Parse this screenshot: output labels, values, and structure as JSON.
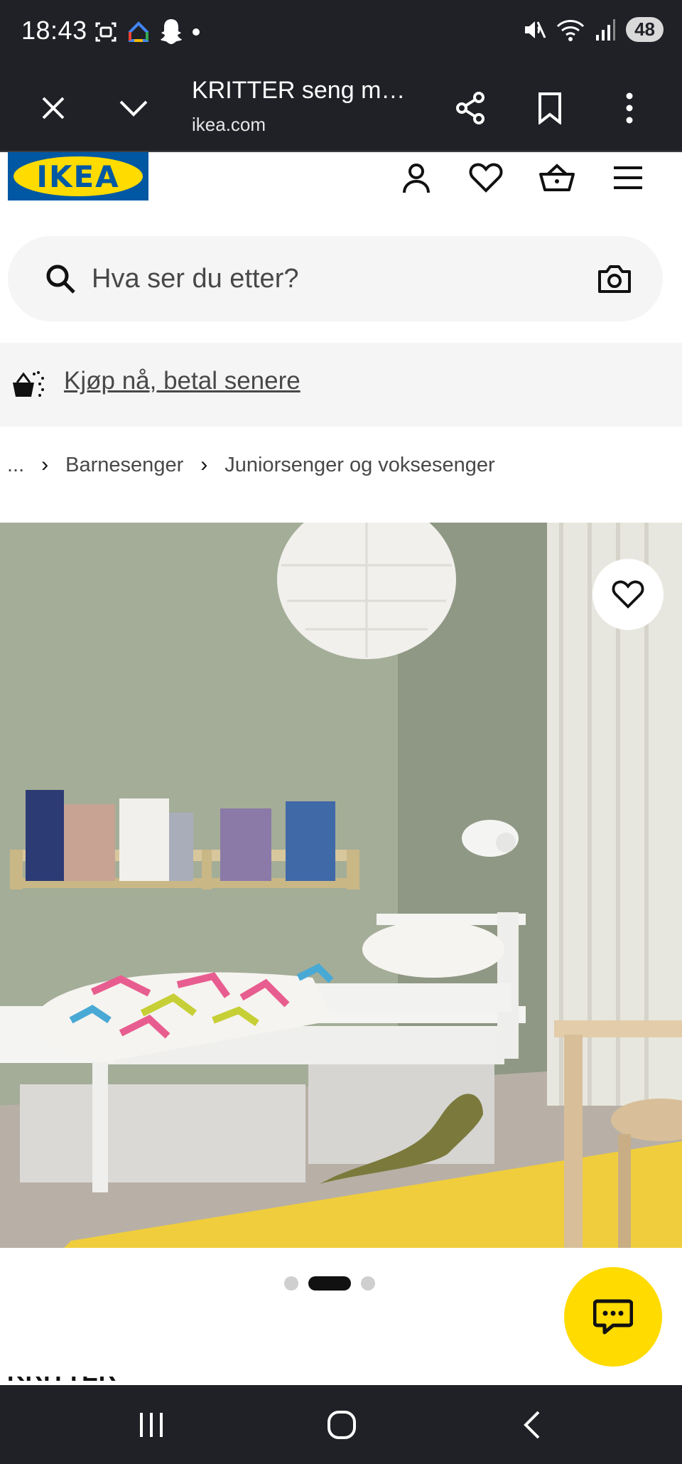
{
  "status_bar": {
    "time": "18:43",
    "battery": "48",
    "icons": [
      "screenshot-icon",
      "google-home-icon",
      "snapchat-icon",
      "notification-dot-icon",
      "mute-icon",
      "wifi-icon",
      "signal-icon"
    ]
  },
  "browser": {
    "title": "KRITTER seng m…",
    "domain": "ikea.com",
    "icons": [
      "close-icon",
      "chevron-down-icon",
      "share-icon",
      "bookmark-icon",
      "more-vertical-icon"
    ]
  },
  "ikea_header": {
    "logo_text": "IKEA",
    "brand_colors": {
      "blue": "#0058a3",
      "yellow": "#ffdb00"
    },
    "icons": [
      "account-icon",
      "heart-icon",
      "cart-icon",
      "menu-icon"
    ]
  },
  "search": {
    "placeholder": "Hva ser du etter?"
  },
  "promo": {
    "link": "Kjøp nå, betal senere"
  },
  "breadcrumb": {
    "ellipsis": "...",
    "items": [
      "Barnesenger",
      "Juniorsenger og voksesenger"
    ]
  },
  "carousel": {
    "count": 3,
    "active_index": 1
  },
  "product": {
    "title_partial": "KRITTER"
  },
  "nav_bar": {
    "icons": [
      "recent-apps-icon",
      "home-icon",
      "back-icon"
    ]
  }
}
